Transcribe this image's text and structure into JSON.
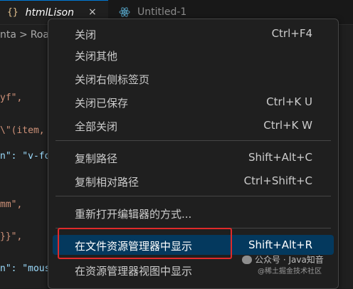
{
  "tabs": [
    {
      "icon": "json-braces-icon",
      "glyph": "{}",
      "label": "htmlLison",
      "close": "×",
      "active": true
    },
    {
      "icon": "react-icon",
      "label": "Untitled-1",
      "active": false
    }
  ],
  "breadcrumb": {
    "part1": "nta",
    "sep": ">",
    "part2": "Roar"
  },
  "code_lines": [
    {
      "text": "yf\","
    },
    {
      "text": "\\\"(item, i"
    },
    {
      "text": "n\": \"v-for"
    },
    {
      "text": "mm\","
    },
    {
      "text": "}}\","
    },
    {
      "text": "n\": \"mous"
    }
  ],
  "menu": {
    "items": [
      {
        "label": "关闭",
        "shortcut": "Ctrl+F4"
      },
      {
        "label": "关闭其他",
        "shortcut": ""
      },
      {
        "label": "关闭右侧标签页",
        "shortcut": ""
      },
      {
        "label": "关闭已保存",
        "shortcut": "Ctrl+K U"
      },
      {
        "label": "全部关闭",
        "shortcut": "Ctrl+K W"
      },
      {
        "label": "复制路径",
        "shortcut": "Shift+Alt+C"
      },
      {
        "label": "复制相对路径",
        "shortcut": "Ctrl+Shift+C"
      },
      {
        "label": "重新打开编辑器的方式...",
        "shortcut": ""
      },
      {
        "label": "在文件资源管理器中显示",
        "shortcut": "Shift+Alt+R"
      },
      {
        "label": "在资源管理器视图中显示",
        "shortcut": ""
      }
    ]
  },
  "watermark": {
    "main": "公众号 · Java知音",
    "sub": "@稀土掘金技术社区"
  },
  "colors": {
    "accent": "#0078d4",
    "selection": "#04395e",
    "highlight_box": "#e02a2a"
  }
}
